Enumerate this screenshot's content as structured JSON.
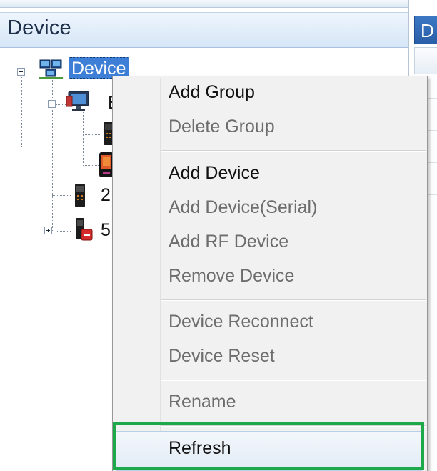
{
  "panel": {
    "title": "Device"
  },
  "right_panel": {
    "tab_label": "D"
  },
  "tree": {
    "root": {
      "label": "Device",
      "expanded": true,
      "selected": true,
      "icon": "network-icon"
    },
    "children": [
      {
        "label": "B",
        "expanded": true,
        "icon": "monitor-icon"
      },
      {
        "label": "",
        "icon": "terminal-device-icon"
      },
      {
        "label": "",
        "icon": "color-screen-device-icon"
      },
      {
        "label": "2",
        "icon": "terminal-device-icon"
      },
      {
        "label": "5",
        "expanded": false,
        "icon": "offline-device-icon"
      }
    ]
  },
  "context_menu": {
    "items": [
      {
        "label": "Add Group",
        "enabled": true
      },
      {
        "label": "Delete Group",
        "enabled": false
      },
      {
        "label": "Add Device",
        "enabled": true
      },
      {
        "label": "Add Device(Serial)",
        "enabled": false
      },
      {
        "label": "Add RF Device",
        "enabled": false
      },
      {
        "label": "Remove Device",
        "enabled": false
      },
      {
        "label": "Device Reconnect",
        "enabled": false
      },
      {
        "label": "Device Reset",
        "enabled": false
      },
      {
        "label": "Rename",
        "enabled": false
      },
      {
        "label": "Refresh",
        "enabled": true,
        "hovered": true,
        "highlighted": true
      }
    ]
  },
  "colors": {
    "selection": "#3d7fd6",
    "highlight_border": "#1da84a",
    "menu_background": "#f1f1f1",
    "disabled_text": "#6d6d6d"
  }
}
